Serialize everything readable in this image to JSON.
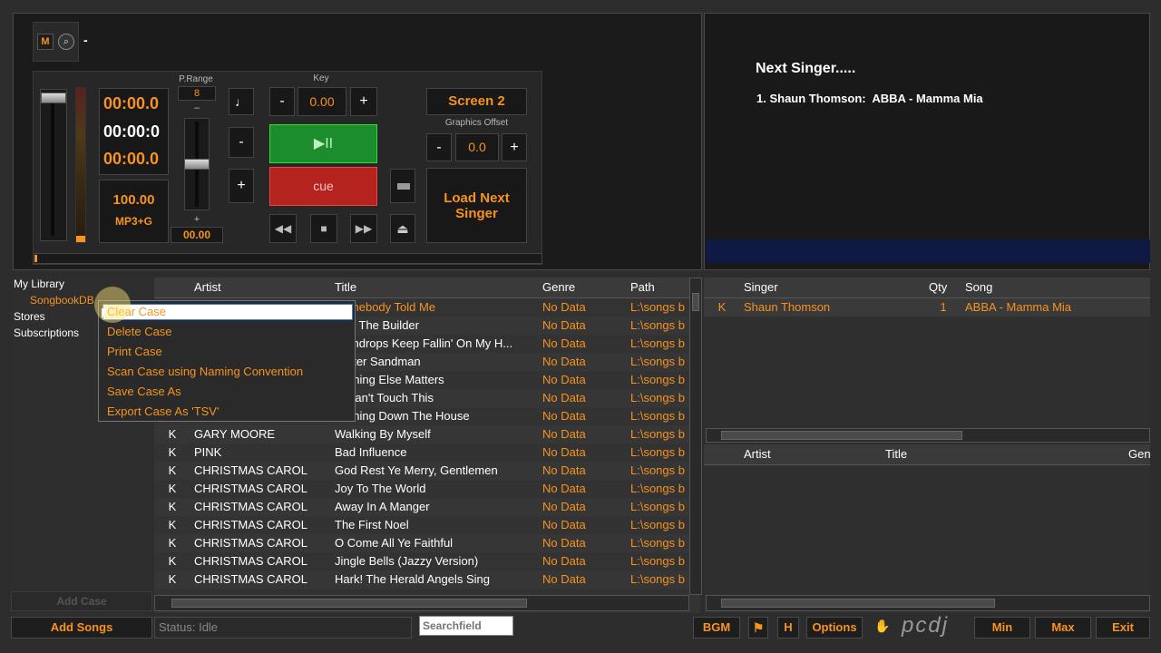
{
  "deck": {
    "m_btn": "M",
    "knob_glyph": "⌕",
    "dash": "-",
    "time1": "00:00.0",
    "time2": "00:00:0",
    "time3": "00:00.0",
    "bpm": "100.00",
    "format": "MP3+G",
    "prange_label": "P.Range",
    "prange_value": "8",
    "prange_minus": "–",
    "prange_plus": "+",
    "prange_bottom": "00.00",
    "key_label": "Key",
    "key_minus": "-",
    "key_value": "0.00",
    "key_plus": "+",
    "tempo_minus": "-",
    "tempo_plus": "+",
    "play_glyph": "▶II",
    "cue_label": "cue",
    "rew_glyph": "◀◀",
    "stop_glyph": "■",
    "ff_glyph": "▶▶",
    "eject_glyph": "⏏",
    "screen_btn": "Screen 2",
    "gfx_label": "Graphics Offset",
    "gfx_minus": "-",
    "gfx_value": "0.0",
    "gfx_plus": "+",
    "load_next": "Load Next Singer"
  },
  "next_singer": {
    "title": "Next Singer.....",
    "line": "1. Shaun Thomson:  ABBA - Mamma Mia"
  },
  "library": {
    "items": [
      "My Library",
      "SongbookDB",
      "Stores",
      "Subscriptions"
    ],
    "add_case": "Add Case"
  },
  "context_menu": [
    "Clear Case",
    "Delete Case",
    "Print Case",
    "Scan Case using Naming Convention",
    "Save Case As",
    "Export Case As 'TSV'"
  ],
  "songs": {
    "headers": [
      "",
      "Artist",
      "Title",
      "Genre",
      "Path"
    ],
    "rows": [
      [
        "",
        "",
        "Somebody Told Me",
        "No Data",
        "L:\\songs b"
      ],
      [
        "",
        "",
        "Bob The Builder",
        "No Data",
        "L:\\songs b"
      ],
      [
        "",
        "",
        "Raindrops Keep Fallin' On My H...",
        "No Data",
        "L:\\songs b"
      ],
      [
        "",
        "",
        "Mister Sandman",
        "No Data",
        "L:\\songs b"
      ],
      [
        "",
        "",
        "Nothing Else Matters",
        "No Data",
        "L:\\songs b"
      ],
      [
        "",
        "",
        "U Can't Touch This",
        "No Data",
        "L:\\songs b"
      ],
      [
        "",
        "",
        "Burning Down The House",
        "No Data",
        "L:\\songs b"
      ],
      [
        "K",
        "GARY MOORE",
        "Walking By Myself",
        "No Data",
        "L:\\songs b"
      ],
      [
        "K",
        "PINK",
        "Bad Influence",
        "No Data",
        "L:\\songs b"
      ],
      [
        "K",
        "CHRISTMAS CAROL",
        "God Rest Ye Merry, Gentlemen",
        "No Data",
        "L:\\songs b"
      ],
      [
        "K",
        "CHRISTMAS CAROL",
        "Joy To The World",
        "No Data",
        "L:\\songs b"
      ],
      [
        "K",
        "CHRISTMAS CAROL",
        "Away In A Manger",
        "No Data",
        "L:\\songs b"
      ],
      [
        "K",
        "CHRISTMAS CAROL",
        "The First Noel",
        "No Data",
        "L:\\songs b"
      ],
      [
        "K",
        "CHRISTMAS CAROL",
        "O Come All Ye Faithful",
        "No Data",
        "L:\\songs b"
      ],
      [
        "K",
        "CHRISTMAS CAROL",
        "Jingle Bells (Jazzy Version)",
        "No Data",
        "L:\\songs b"
      ],
      [
        "K",
        "CHRISTMAS CAROL",
        "Hark! The Herald Angels Sing",
        "No Data",
        "L:\\songs b"
      ]
    ]
  },
  "queue": {
    "headers": [
      "",
      "Singer",
      "Qty",
      "Song"
    ],
    "rows": [
      [
        "K",
        "Shaun Thomson",
        "1",
        "ABBA - Mamma Mia"
      ]
    ]
  },
  "history": {
    "headers": [
      "",
      "Artist",
      "Title",
      "Gen"
    ]
  },
  "bottom": {
    "add_songs": "Add Songs",
    "status": "Status: Idle",
    "search_placeholder": "Searchfield",
    "bgm": "BGM",
    "h": "H",
    "options": "Options",
    "logo": "pcdj",
    "min": "Min",
    "max": "Max",
    "exit": "Exit"
  }
}
